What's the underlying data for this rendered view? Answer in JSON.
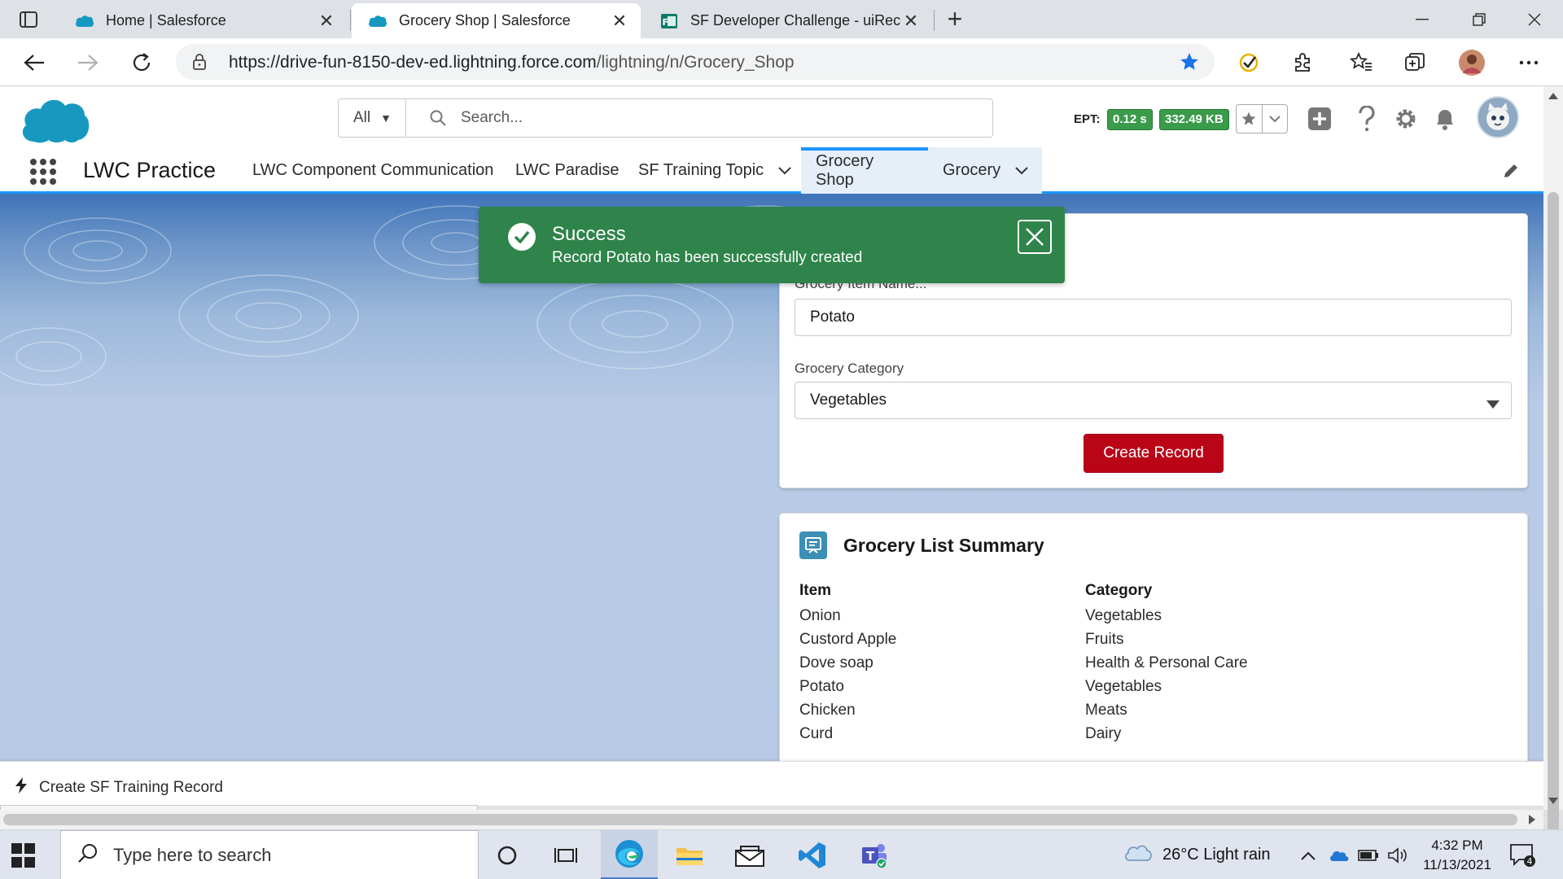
{
  "browser": {
    "tabs": [
      {
        "title": "Home | Salesforce",
        "active": false
      },
      {
        "title": "Grocery Shop | Salesforce",
        "active": true
      },
      {
        "title": "SF Developer Challenge - uiReco",
        "active": false
      }
    ],
    "new_tab_label": "+",
    "close_label": "✕",
    "url_host": "https://drive-fun-8150-dev-ed.lightning.force.com",
    "url_path": "/lightning/n/Grocery_Shop"
  },
  "sf_header": {
    "search_scope": "All",
    "search_placeholder": "Search...",
    "ept_label": "EPT:",
    "ept_time": "0.12 s",
    "ept_size": "332.49 KB"
  },
  "sf_nav": {
    "app_name": "LWC Practice",
    "items": [
      {
        "label": "LWC Component Communication",
        "active": false,
        "dropdown": false
      },
      {
        "label": "LWC Paradise",
        "active": false,
        "dropdown": false
      },
      {
        "label": "SF Training Topic",
        "active": false,
        "dropdown": true
      },
      {
        "label": "Grocery Shop",
        "active": true,
        "dropdown": false
      },
      {
        "label": "Grocery",
        "active": true,
        "dropdown": true
      }
    ]
  },
  "form": {
    "name_label": "Grocery Item Name...",
    "name_value": "Potato",
    "category_label": "Grocery Category",
    "category_value": "Vegetables",
    "create_button": "Create Record"
  },
  "summary": {
    "title": "Grocery List Summary",
    "item_header": "Item",
    "category_header": "Category",
    "rows": [
      {
        "item": "Onion",
        "category": "Vegetables"
      },
      {
        "item": "Custord Apple",
        "category": "Fruits"
      },
      {
        "item": "Dove soap",
        "category": "Health & Personal Care"
      },
      {
        "item": "Potato",
        "category": "Vegetables"
      },
      {
        "item": "Chicken",
        "category": "Meats"
      },
      {
        "item": "Curd",
        "category": "Dairy"
      }
    ]
  },
  "toast": {
    "title": "Success",
    "message": "Record Potato has been successfully created"
  },
  "utility": {
    "item_label": "Create SF Training Record"
  },
  "status_url": "https://drive-fun-8150-dev-ed.lightning.force.com/lightning/o/Grocery__c/h...",
  "taskbar": {
    "search_placeholder": "Type here to search",
    "weather": "26°C  Light rain",
    "time": "4:32 PM",
    "date": "11/13/2021",
    "notification_count": "4"
  },
  "colors": {
    "sf_blue": "#1b96ff",
    "toast_green": "#2e844a",
    "button_red": "#ba0517",
    "ept_green": "#3a9b4b"
  }
}
